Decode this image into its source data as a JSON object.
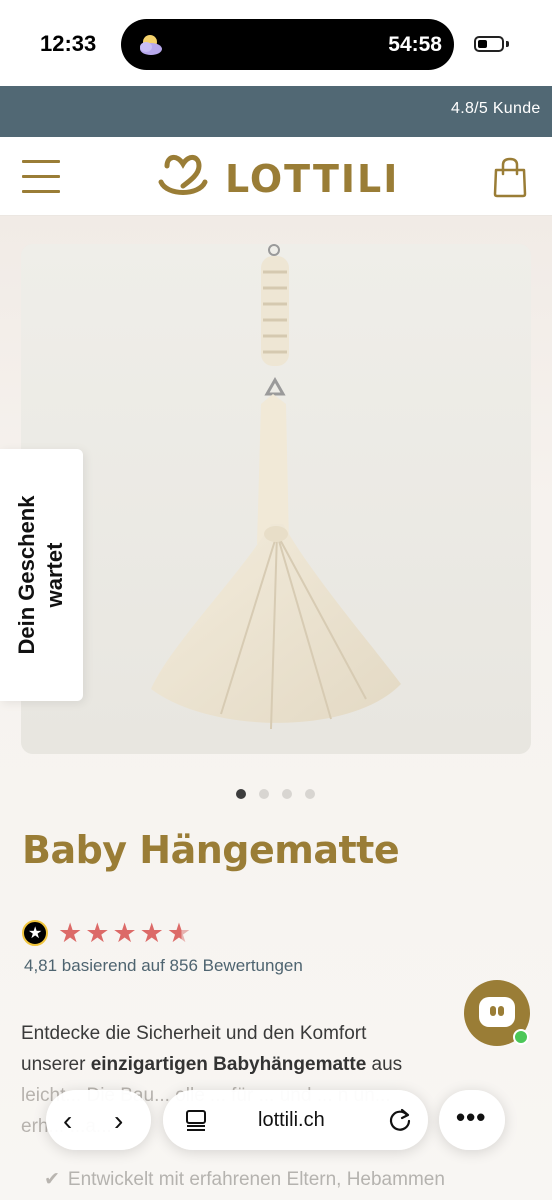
{
  "status_bar": {
    "time": "12:33",
    "island_timer": "54:58",
    "island_icon": "weather-cloud-moon-icon",
    "battery_icon": "battery-low-icon"
  },
  "announcement": {
    "text": "4.8/5 Kunde"
  },
  "header": {
    "menu_icon": "hamburger-menu-icon",
    "logo_text": "LOTTILI",
    "logo_icon": "heart-logo-icon",
    "cart_icon": "shopping-bag-icon",
    "brand_color": "#9a7d36"
  },
  "gallery": {
    "image": "baby-hammock-product-photo",
    "dots": 4,
    "active_dot": 1
  },
  "side_tab": {
    "line1": "Dein Geschenk",
    "line2": "wartet"
  },
  "product": {
    "title": "Baby Hängematte",
    "rating_value": 4.81,
    "rating_max": 5,
    "rating_text": "4,81 basierend auf 856 Bewertungen",
    "star_color": "#dc6a68"
  },
  "description": {
    "line1": "Entdecke die Sicherheit und den Komfort",
    "line2_a": "unserer",
    "line2_bold": "einzigartigen Babyhängematte",
    "line2_b": "aus",
    "line3": "leicht... Die Bau... olle ... für ... und ... n un...",
    "line4": "erh... ...a..."
  },
  "benefit": {
    "text": "Entwickelt mit erfahrenen Eltern, Hebammen"
  },
  "chat": {
    "icon": "chat-bubble-icon",
    "online_color": "#4cc758"
  },
  "browser": {
    "back_icon": "chevron-left-icon",
    "forward_icon": "chevron-right-icon",
    "reader_icon": "reader-mode-icon",
    "url": "lottili.ch",
    "reload_icon": "reload-icon",
    "more_icon": "more-dots-icon"
  }
}
